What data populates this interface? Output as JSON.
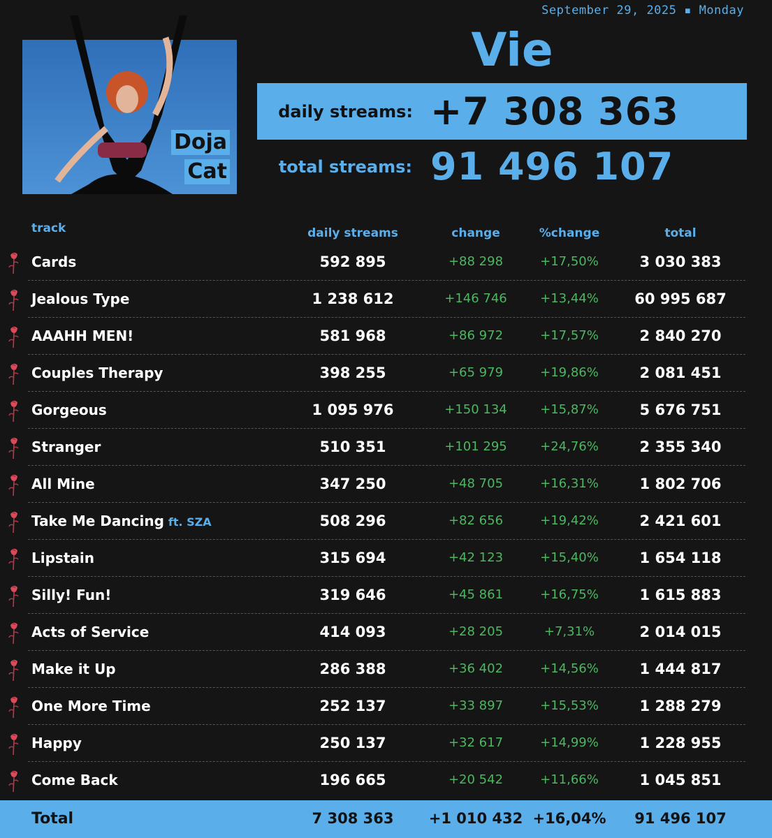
{
  "header": {
    "date": "September 29, 2025 ▪ Monday",
    "album_title": "Vie",
    "artist_lines": [
      "Doja",
      "Cat"
    ],
    "daily_label": "daily streams:",
    "daily_value": "+7 308 363",
    "total_label": "total streams:",
    "total_value": "91 496 107"
  },
  "table": {
    "columns": {
      "track": "track",
      "daily": "daily streams",
      "change": "change",
      "pct": "%change",
      "total": "total"
    },
    "row_icon": "rose-icon",
    "rows": [
      {
        "track": "Cards",
        "feat": "",
        "daily": "592 895",
        "change": "+88 298",
        "pct": "+17,50%",
        "total": "3 030 383"
      },
      {
        "track": "Jealous Type",
        "feat": "",
        "daily": "1 238 612",
        "change": "+146 746",
        "pct": "+13,44%",
        "total": "60 995 687"
      },
      {
        "track": "AAAHH MEN!",
        "feat": "",
        "daily": "581 968",
        "change": "+86 972",
        "pct": "+17,57%",
        "total": "2 840 270"
      },
      {
        "track": "Couples Therapy",
        "feat": "",
        "daily": "398 255",
        "change": "+65 979",
        "pct": "+19,86%",
        "total": "2 081 451"
      },
      {
        "track": "Gorgeous",
        "feat": "",
        "daily": "1 095 976",
        "change": "+150 134",
        "pct": "+15,87%",
        "total": "5 676 751"
      },
      {
        "track": "Stranger",
        "feat": "",
        "daily": "510 351",
        "change": "+101 295",
        "pct": "+24,76%",
        "total": "2 355 340"
      },
      {
        "track": "All Mine",
        "feat": "",
        "daily": "347 250",
        "change": "+48 705",
        "pct": "+16,31%",
        "total": "1 802 706"
      },
      {
        "track": "Take Me Dancing",
        "feat": "ft. SZA",
        "daily": "508 296",
        "change": "+82 656",
        "pct": "+19,42%",
        "total": "2 421 601"
      },
      {
        "track": "Lipstain",
        "feat": "",
        "daily": "315 694",
        "change": "+42 123",
        "pct": "+15,40%",
        "total": "1 654 118"
      },
      {
        "track": "Silly! Fun!",
        "feat": "",
        "daily": "319 646",
        "change": "+45 861",
        "pct": "+16,75%",
        "total": "1 615 883"
      },
      {
        "track": "Acts of Service",
        "feat": "",
        "daily": "414 093",
        "change": "+28 205",
        "pct": "+7,31%",
        "total": "2 014 015"
      },
      {
        "track": "Make it Up",
        "feat": "",
        "daily": "286 388",
        "change": "+36 402",
        "pct": "+14,56%",
        "total": "1 444 817"
      },
      {
        "track": "One More Time",
        "feat": "",
        "daily": "252 137",
        "change": "+33 897",
        "pct": "+15,53%",
        "total": "1 288 279"
      },
      {
        "track": "Happy",
        "feat": "",
        "daily": "250 137",
        "change": "+32 617",
        "pct": "+14,99%",
        "total": "1 228 955"
      },
      {
        "track": "Come Back",
        "feat": "",
        "daily": "196 665",
        "change": "+20 542",
        "pct": "+11,66%",
        "total": "1 045 851"
      }
    ],
    "footer": {
      "label": "Total",
      "daily": "7 308 363",
      "change": "+1 010 432",
      "pct": "+16,04%",
      "total": "91 496 107"
    }
  },
  "colors": {
    "accent": "#5aaeea",
    "background": "#151515",
    "positive": "#4bb85f",
    "rose": "#d94a5a"
  }
}
